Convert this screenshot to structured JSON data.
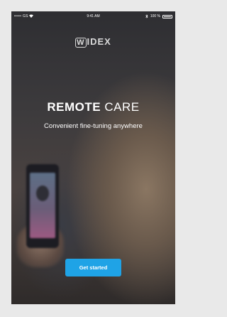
{
  "status_bar": {
    "carrier": "••••• GS",
    "time": "9:41 AM",
    "battery": "100 %"
  },
  "brand": {
    "logo_text": "IDEX",
    "logo_mark": "W"
  },
  "hero": {
    "title_bold": "REMOTE",
    "title_light": "CARE",
    "subtitle": "Convenient fine-tuning anywhere"
  },
  "actions": {
    "get_started_label": "Get started"
  },
  "colors": {
    "accent": "#1fa3e6",
    "page_background": "#e9e9e9"
  },
  "icons": [
    "wifi-icon",
    "bluetooth-icon",
    "battery-icon"
  ]
}
